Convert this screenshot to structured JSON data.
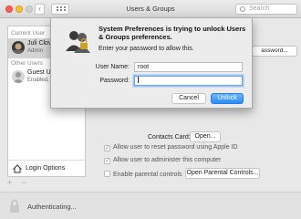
{
  "window": {
    "title": "Users & Groups",
    "search_placeholder": "Search"
  },
  "sidebar": {
    "current_user_label": "Current User",
    "other_users_label": "Other Users",
    "users": [
      {
        "name": "Juli Clove",
        "role": "Admin"
      },
      {
        "name": "Guest Us",
        "role": "Enabled, M"
      }
    ],
    "login_options_label": "Login Options",
    "add_symbol": "+",
    "remove_symbol": "−"
  },
  "main": {
    "password_button": "assword...",
    "contacts_card_label": "Contacts Card:",
    "open_button": "Open...",
    "checks": [
      {
        "label": "Allow user to reset password using Apple ID",
        "checked": true
      },
      {
        "label": "Allow user to administer this computer",
        "checked": true
      },
      {
        "label": "Enable parental controls",
        "checked": false
      }
    ],
    "open_parental_button": "Open Parental Controls..."
  },
  "bottom": {
    "auth_label": "Authenticating..."
  },
  "dialog": {
    "title": "System Preferences is trying to unlock Users & Groups preferences.",
    "message": "Enter your password to allow this.",
    "username_label": "User Name:",
    "username_value": "root",
    "password_label": "Password:",
    "password_value": "",
    "cancel_label": "Cancel",
    "unlock_label": "Unlock"
  },
  "colors": {
    "accent": "#2a8ef4",
    "window_bg": "#e8e8e8"
  }
}
